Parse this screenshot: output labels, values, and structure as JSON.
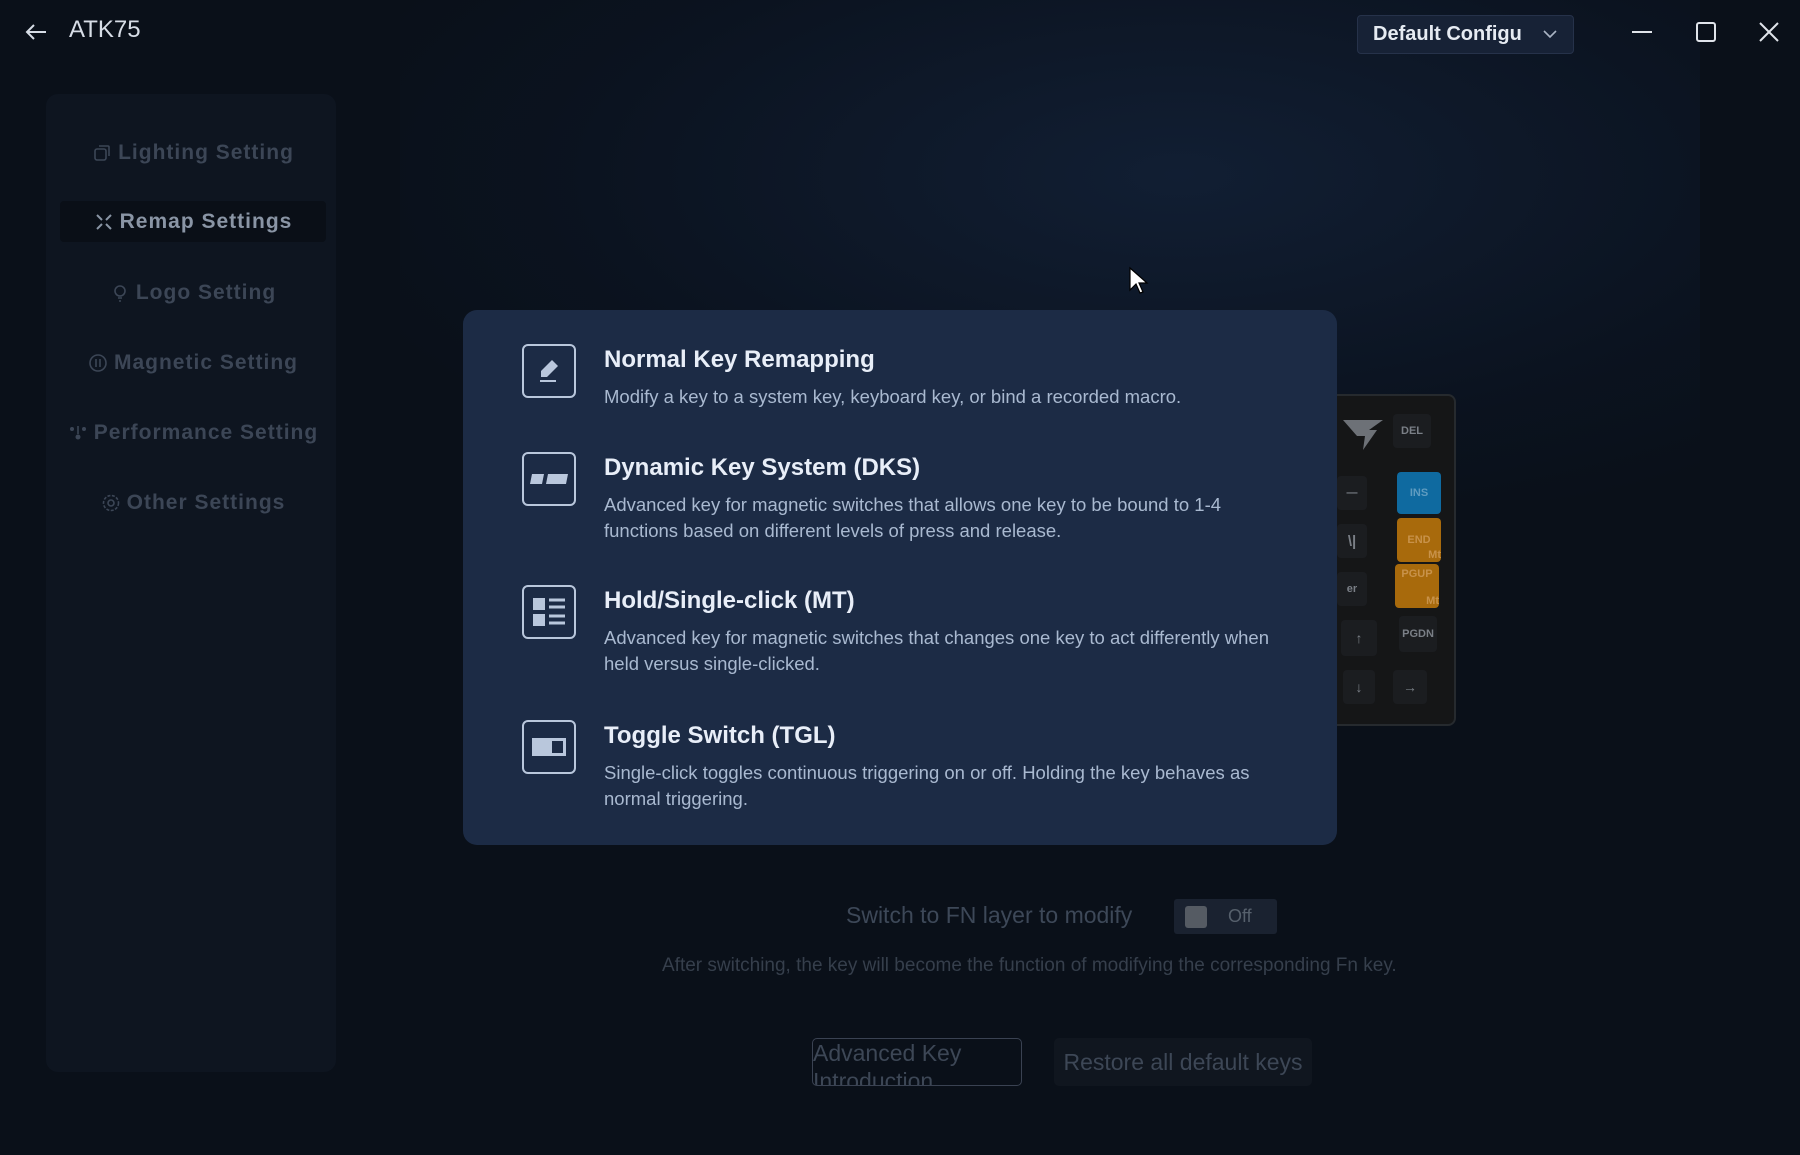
{
  "app": {
    "title": "ATK75",
    "config_dropdown": "Default Configu"
  },
  "sidebar": {
    "items": [
      {
        "label": "Lighting Setting",
        "icon": "lighting-icon"
      },
      {
        "label": "Remap Settings",
        "icon": "remap-icon",
        "active": true
      },
      {
        "label": "Logo Setting",
        "icon": "logo-bulb-icon"
      },
      {
        "label": "Magnetic Setting",
        "icon": "magnetic-icon"
      },
      {
        "label": "Performance Setting",
        "icon": "performance-icon"
      },
      {
        "label": "Other Settings",
        "icon": "gear-icon"
      }
    ]
  },
  "keyboard": {
    "keys": [
      "DEL",
      "INS",
      "END",
      "Mt",
      "PGUP",
      "Mt",
      "PGDN",
      "—",
      "\\|",
      "er",
      "↑",
      "↓",
      "→"
    ],
    "colors": {
      "ins": "#0f6aa0",
      "mt": "#a86a0c"
    }
  },
  "modal": {
    "options": [
      {
        "title": "Normal Key Remapping",
        "desc": "Modify a key to a system key, keyboard key, or bind a recorded macro.",
        "icon": "pencil-icon"
      },
      {
        "title": "Dynamic Key System (DKS)",
        "desc": "Advanced key for magnetic switches that allows one key to be bound to 1-4 functions based on different levels of press and release.",
        "icon": "dks-icon"
      },
      {
        "title": "Hold/Single-click (MT)",
        "desc": "Advanced key for magnetic switches that changes one key to act differently when held versus single-clicked.",
        "icon": "list-icon"
      },
      {
        "title": "Toggle Switch (TGL)",
        "desc": "Single-click toggles continuous triggering on or off. Holding the key behaves as normal triggering.",
        "icon": "toggle-icon"
      }
    ]
  },
  "fn": {
    "label": "Switch to FN layer to modify",
    "toggle": "Off",
    "hint": "After switching, the key will become the function of modifying the corresponding Fn key."
  },
  "buttons": {
    "advanced": "Advanced Key Introduction",
    "restore": "Restore all default keys"
  }
}
